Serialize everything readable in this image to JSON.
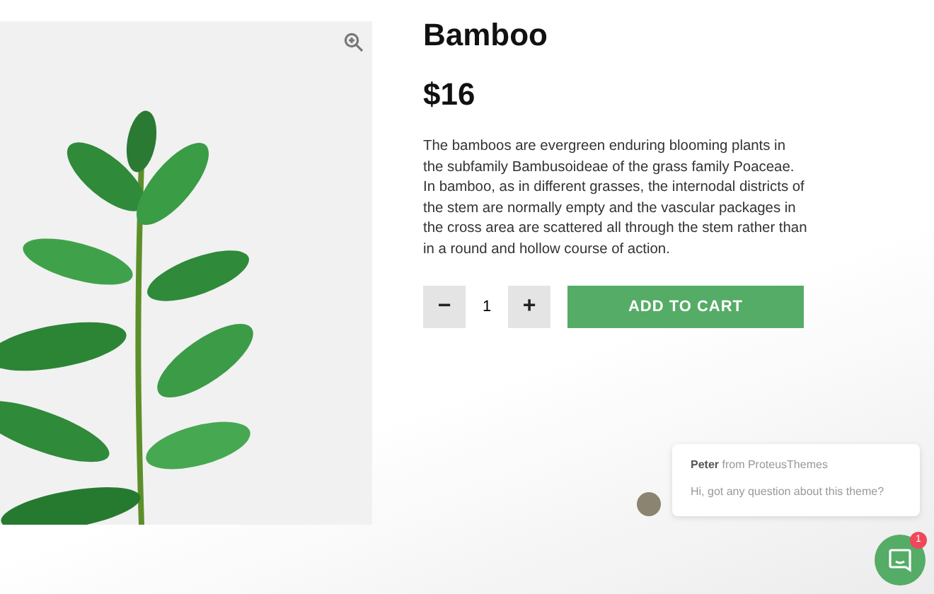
{
  "product": {
    "title": "Bamboo",
    "price": "$16",
    "description": "The bamboos are evergreen enduring blooming plants in the subfamily Bambusoideae of the grass family Poaceae. In bamboo, as in different grasses, the internodal districts of the stem are normally empty and the vascular packages in the cross area are scattered all through the stem rather than in a round and hollow course of action.",
    "quantity": "1",
    "decrease": "−",
    "increase": "+",
    "add_to_cart": "ADD TO CART"
  },
  "chat": {
    "sender": "Peter",
    "sender_org": "from ProteusThemes",
    "message": "Hi, got any question about this theme?",
    "unread_count": "1"
  }
}
